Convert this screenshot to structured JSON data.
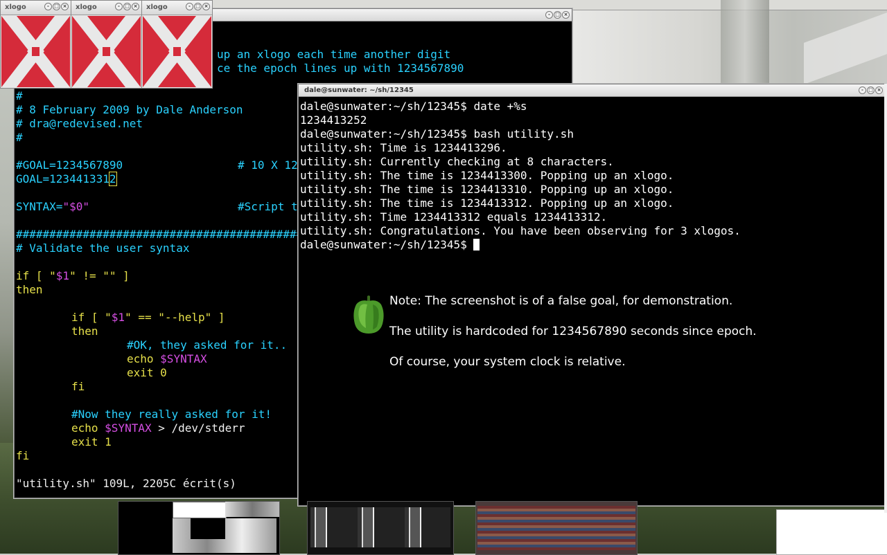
{
  "xlogos": [
    {
      "title": "xlogo"
    },
    {
      "title": "xlogo"
    },
    {
      "title": "xlogo"
    }
  ],
  "vim_window": {
    "partial_lines": {
      "l1": "up an xlogo each time another digit",
      "l2": "ce the epoch lines up with 1234567890"
    },
    "comment_hash": "#",
    "comment_date": "# 8 February 2009 by Dale Anderson",
    "comment_email": "# dra@redevised.net",
    "comment_hash2": "#",
    "goal_comment": "#GOAL=1234567890",
    "goal_comment_tail": "# 10 X 12",
    "goal_line_prefix": "GOAL=123441331",
    "goal_line_cursor_char": "2",
    "syntax_name": "SYNTAX=",
    "syntax_value": "\"$0\"",
    "syntax_comment": "#Script t",
    "hash_row": "#################################################",
    "validate_comment": "# Validate the user syntax",
    "if1_a": "if [ \"",
    "if1_var": "$1",
    "if1_b": "\" != \"\" ]",
    "then1": "then",
    "if2_a": "if [ \"",
    "if2_var": "$1",
    "if2_b": "\" == \"--help\" ]",
    "then2": "then",
    "ok_comment": "#OK, they asked for it..",
    "echo1": "echo ",
    "echo1_var": "$SYNTAX",
    "exit0": "exit 0",
    "fi1": "fi",
    "now_comment": "#Now they really asked for it!",
    "echo2": "echo ",
    "echo2_var": "$SYNTAX",
    "echo2_tail": " > /dev/stderr",
    "exit1": "exit 1",
    "fi2": "fi",
    "status_line": "\"utility.sh\" 109L, 2205C écrit(s)"
  },
  "main_terminal": {
    "title": "dale@sunwater: ~/sh/12345",
    "lines": [
      "dale@sunwater:~/sh/12345$ date +%s",
      "1234413252",
      "dale@sunwater:~/sh/12345$ bash utility.sh",
      "utility.sh: Time is 1234413296.",
      "utility.sh: Currently checking at 8 characters.",
      "utility.sh: The time is 1234413300. Popping up an xlogo.",
      "utility.sh: The time is 1234413310. Popping up an xlogo.",
      "utility.sh: The time is 1234413312. Popping up an xlogo.",
      "utility.sh: Time 1234413312 equals 1234413312.",
      "utility.sh: Congratulations. You have been observing for 3 xlogos."
    ],
    "prompt": "dale@sunwater:~/sh/12345$ "
  },
  "note": {
    "line1": "Note: The screenshot is of a false goal, for demonstration.",
    "line2": "The utility is hardcoded for 1234567890 seconds since epoch.",
    "line3": "Of course, your system clock is relative."
  },
  "icons": {
    "pepper": "green-bell-pepper-icon",
    "xlogo": "x-logo-icon"
  },
  "colors": {
    "xlogo_red": "#d52b3a",
    "vim_cyan": "#2ad2ff",
    "vim_magenta": "#d64fe4",
    "vim_yellow": "#e6e04a"
  }
}
